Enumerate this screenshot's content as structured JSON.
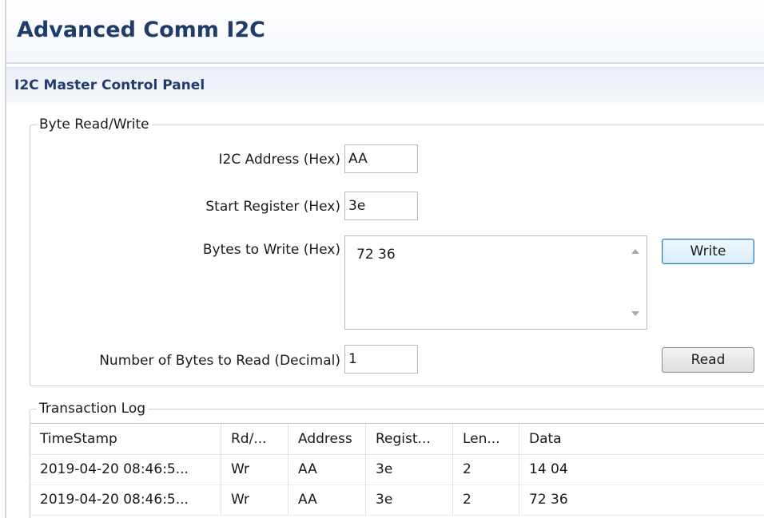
{
  "header": {
    "title": "Advanced Comm I2C"
  },
  "panel": {
    "title": "I2C Master Control Panel"
  },
  "byte_rw": {
    "legend": "Byte Read/Write",
    "address_label": "I2C Address (Hex)",
    "address_value": "AA",
    "start_register_label": "Start Register (Hex)",
    "start_register_value": "3e",
    "bytes_to_write_label": "Bytes to Write (Hex)",
    "bytes_to_write_value": "72 36",
    "write_button": "Write",
    "bytes_to_read_label": "Number of Bytes to Read (Decimal)",
    "bytes_to_read_value": "1",
    "read_button": "Read"
  },
  "log": {
    "legend": "Transaction Log",
    "columns": [
      "TimeStamp",
      "Rd/...",
      "Address",
      "Regist...",
      "Len...",
      "Data"
    ],
    "rows": [
      [
        "2019-04-20 08:46:5...",
        "Wr",
        "AA",
        "3e",
        "2",
        "14 04"
      ],
      [
        "2019-04-20 08:46:5...",
        "Wr",
        "AA",
        "3e",
        "2",
        "72 36"
      ]
    ]
  },
  "colors": {
    "title_text": "#1f3c6b",
    "focused_button_border": "#3c7fb1"
  }
}
